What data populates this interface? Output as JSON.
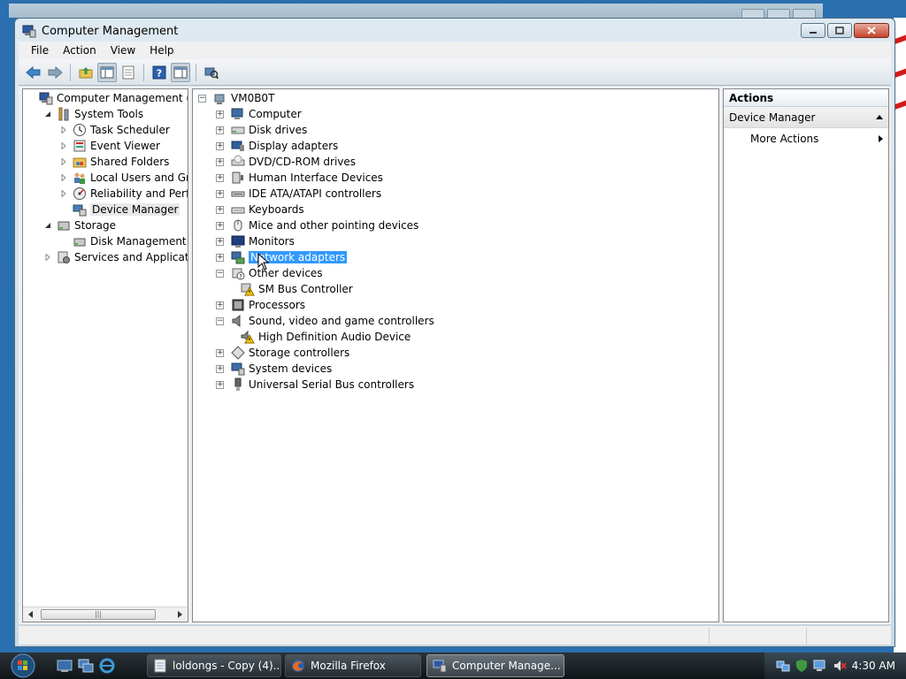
{
  "window": {
    "title": "Computer Management",
    "buttons": {
      "minimize": "minimize",
      "maximize": "maximize",
      "close": "close"
    }
  },
  "menu": [
    "File",
    "Action",
    "View",
    "Help"
  ],
  "left_tree": [
    {
      "label": "Computer Management (Local",
      "level": 0,
      "expander": "none",
      "icon": "computer-management-icon"
    },
    {
      "label": "System Tools",
      "level": 1,
      "expander": "expanded",
      "icon": "system-tools-icon"
    },
    {
      "label": "Task Scheduler",
      "level": 2,
      "expander": "collapsed",
      "icon": "task-scheduler-icon"
    },
    {
      "label": "Event Viewer",
      "level": 2,
      "expander": "collapsed",
      "icon": "event-viewer-icon"
    },
    {
      "label": "Shared Folders",
      "level": 2,
      "expander": "collapsed",
      "icon": "shared-folders-icon"
    },
    {
      "label": "Local Users and Groups",
      "level": 2,
      "expander": "collapsed",
      "icon": "users-icon"
    },
    {
      "label": "Reliability and Performa",
      "level": 2,
      "expander": "collapsed",
      "icon": "reliability-icon"
    },
    {
      "label": "Device Manager",
      "level": 2,
      "expander": "none",
      "icon": "device-manager-icon",
      "selected": true
    },
    {
      "label": "Storage",
      "level": 1,
      "expander": "expanded",
      "icon": "storage-icon"
    },
    {
      "label": "Disk Management",
      "level": 2,
      "expander": "none",
      "icon": "disk-management-icon"
    },
    {
      "label": "Services and Applications",
      "level": 1,
      "expander": "collapsed",
      "icon": "services-icon"
    }
  ],
  "device_tree": {
    "root": "VM0B0T",
    "items": [
      {
        "label": "Computer",
        "level": 1,
        "expander": "plus",
        "icon": "computer-icon"
      },
      {
        "label": "Disk drives",
        "level": 1,
        "expander": "plus",
        "icon": "disk-drive-icon"
      },
      {
        "label": "Display adapters",
        "level": 1,
        "expander": "plus",
        "icon": "display-adapter-icon"
      },
      {
        "label": "DVD/CD-ROM drives",
        "level": 1,
        "expander": "plus",
        "icon": "dvd-drive-icon"
      },
      {
        "label": "Human Interface Devices",
        "level": 1,
        "expander": "plus",
        "icon": "hid-icon"
      },
      {
        "label": "IDE ATA/ATAPI controllers",
        "level": 1,
        "expander": "plus",
        "icon": "ide-controller-icon"
      },
      {
        "label": "Keyboards",
        "level": 1,
        "expander": "plus",
        "icon": "keyboard-icon"
      },
      {
        "label": "Mice and other pointing devices",
        "level": 1,
        "expander": "plus",
        "icon": "mouse-icon"
      },
      {
        "label": "Monitors",
        "level": 1,
        "expander": "plus",
        "icon": "monitor-icon"
      },
      {
        "label": "Network adapters",
        "level": 1,
        "expander": "plus",
        "icon": "network-adapter-icon",
        "selected": true
      },
      {
        "label": "Other devices",
        "level": 1,
        "expander": "minus",
        "icon": "other-devices-icon"
      },
      {
        "label": "SM Bus Controller",
        "level": 2,
        "expander": "none",
        "icon": "warning-device-icon"
      },
      {
        "label": "Processors",
        "level": 1,
        "expander": "plus",
        "icon": "processor-icon"
      },
      {
        "label": "Sound, video and game controllers",
        "level": 1,
        "expander": "minus",
        "icon": "sound-icon"
      },
      {
        "label": "High Definition Audio Device",
        "level": 2,
        "expander": "none",
        "icon": "warning-audio-icon"
      },
      {
        "label": "Storage controllers",
        "level": 1,
        "expander": "plus",
        "icon": "storage-controller-icon"
      },
      {
        "label": "System devices",
        "level": 1,
        "expander": "plus",
        "icon": "system-devices-icon"
      },
      {
        "label": "Universal Serial Bus controllers",
        "level": 1,
        "expander": "plus",
        "icon": "usb-icon"
      }
    ]
  },
  "actions": {
    "header": "Actions",
    "section": "Device Manager",
    "items": [
      "More Actions"
    ]
  },
  "taskbar": {
    "tasks": [
      {
        "label": "loldongs - Copy (4)....",
        "icon": "notepad-icon"
      },
      {
        "label": "Mozilla Firefox",
        "icon": "firefox-icon"
      },
      {
        "label": "Computer Manage...",
        "icon": "computer-management-icon",
        "active": true
      }
    ],
    "clock": "4:30 AM"
  },
  "colors": {
    "selection": "#3399ff",
    "taskbar": "#1b2329"
  }
}
